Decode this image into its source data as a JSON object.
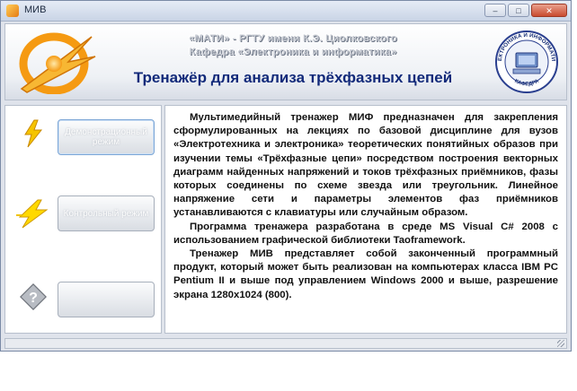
{
  "window": {
    "title": "МИВ",
    "controls": {
      "minimize": "–",
      "maximize": "□",
      "close": "✕"
    }
  },
  "header": {
    "line1": "«МАТИ» - РГТУ имени К.Э. Циолковского",
    "line2": "Кафедра «Электроника и информатика»",
    "title": "Тренажёр для анализа трёхфазных цепей",
    "logo_right_arc_text": "ЭЛЕКТРОНИКА И ИНФОРМАТИКА",
    "logo_right_bottom_text": "КАФЕДРА"
  },
  "sidebar": {
    "items": [
      {
        "icon": "lightning-bolt-icon",
        "label": "Демонстрационный режим"
      },
      {
        "icon": "lightning-bolt-icon",
        "label": "Контрольный режим"
      },
      {
        "icon": "question-mark-icon",
        "label": ""
      }
    ]
  },
  "content": {
    "paragraphs": [
      "Мультимедийный тренажер МИФ предназначен для закрепления сформулированных на лекциях по базовой дисциплине для вузов «Электротехника и электроника» теоретических понятийных образов при изучении темы «Трёхфазные цепи» посредством построения векторных диаграмм найденных напряжений и токов трёхфазных приёмников, фазы которых соединены по схеме звезда или треугольник. Линейное напряжение сети и параметры элементов фаз приёмников устанавливаются с клавиатуры или случайным образом.",
      "Программа тренажера разработана в среде MS Visual C# 2008 с использованием графической библиотеки Taoframework.",
      "Тренажер МИВ представляет собой законченный программный продукт, который может быть реализован на компьютерах класса IBM PC Pentium II и выше под управлением Windows 2000 и выше, разрешение экрана 1280x1024 (800)."
    ]
  },
  "colors": {
    "title_text": "#122a7a",
    "logo_orange": "#f59a12",
    "bolt_yellow": "#f5c400"
  }
}
